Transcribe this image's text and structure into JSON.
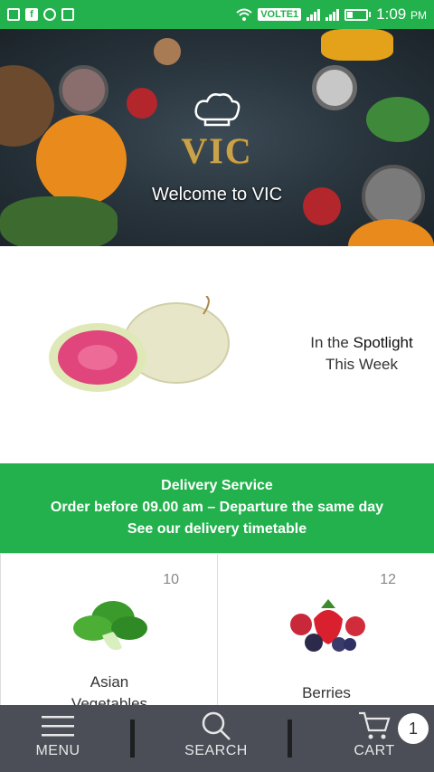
{
  "status_bar": {
    "network_badge": "VOLTE1",
    "time": "1:09",
    "time_suffix": "PM"
  },
  "hero": {
    "logo_text": "VIC",
    "title": "Welcome to VIC"
  },
  "spotlight": {
    "line1_prefix": "In the ",
    "line1_emphasis": "Spotlight",
    "line2": "This Week"
  },
  "delivery": {
    "line1": "Delivery Service",
    "line2": "Order before 09.00 am – Departure the same day",
    "line3": "See our delivery timetable"
  },
  "categories": [
    {
      "label_line1": "Asian",
      "label_line2": "Vegetables",
      "count": "10"
    },
    {
      "label_line1": "Berries",
      "count": "12"
    }
  ],
  "bottom_nav": {
    "menu_label": "MENU",
    "search_label": "SEARCH",
    "cart_label": "CART",
    "cart_count": "1"
  },
  "colors": {
    "brand_green": "#22b14c",
    "nav_background": "#4b4e56"
  }
}
